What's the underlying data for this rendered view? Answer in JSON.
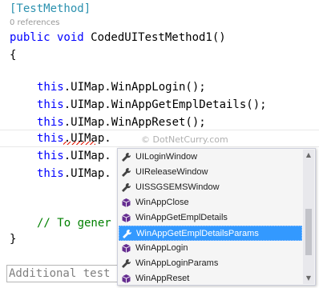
{
  "editor": {
    "attribute": "[TestMethod]",
    "references": "0 references",
    "signature_kw": "public void",
    "signature_rest": " CodedUITestMethod1()",
    "open_brace": "{",
    "this_kw": "this",
    "line_login": ".UIMap.WinAppLogin();",
    "line_get": ".UIMap.WinAppGetEmplDetails();",
    "line_reset": ".UIMap.WinAppReset();",
    "line_current": ".UIMap.",
    "line_partial_1": ".UIMap.",
    "line_partial_2": ".UIMap.",
    "comment": "// To gener",
    "close_brace": "}",
    "additional": "Additional test"
  },
  "watermark": "© DotNetCurry.com",
  "intellisense": {
    "items": [
      {
        "label": "UILoginWindow",
        "icon": "wrench-icon"
      },
      {
        "label": "UIReleaseWindow",
        "icon": "wrench-icon"
      },
      {
        "label": "UISSGSEMSWindow",
        "icon": "wrench-icon"
      },
      {
        "label": "WinAppClose",
        "icon": "method-cube-icon"
      },
      {
        "label": "WinAppGetEmplDetails",
        "icon": "method-cube-icon"
      },
      {
        "label": "WinAppGetEmplDetailsParams",
        "icon": "wrench-icon",
        "selected": true
      },
      {
        "label": "WinAppLogin",
        "icon": "method-cube-icon"
      },
      {
        "label": "WinAppLoginParams",
        "icon": "wrench-icon"
      },
      {
        "label": "WinAppReset",
        "icon": "method-cube-icon"
      }
    ],
    "scroll_up": "▲",
    "scroll_down": "▼"
  },
  "colors": {
    "keyword": "#0000ff",
    "type_attr": "#2b91af",
    "comment": "#008000",
    "selection": "#3399ff",
    "method_icon": "#652d90",
    "property_icon": "#424242"
  }
}
